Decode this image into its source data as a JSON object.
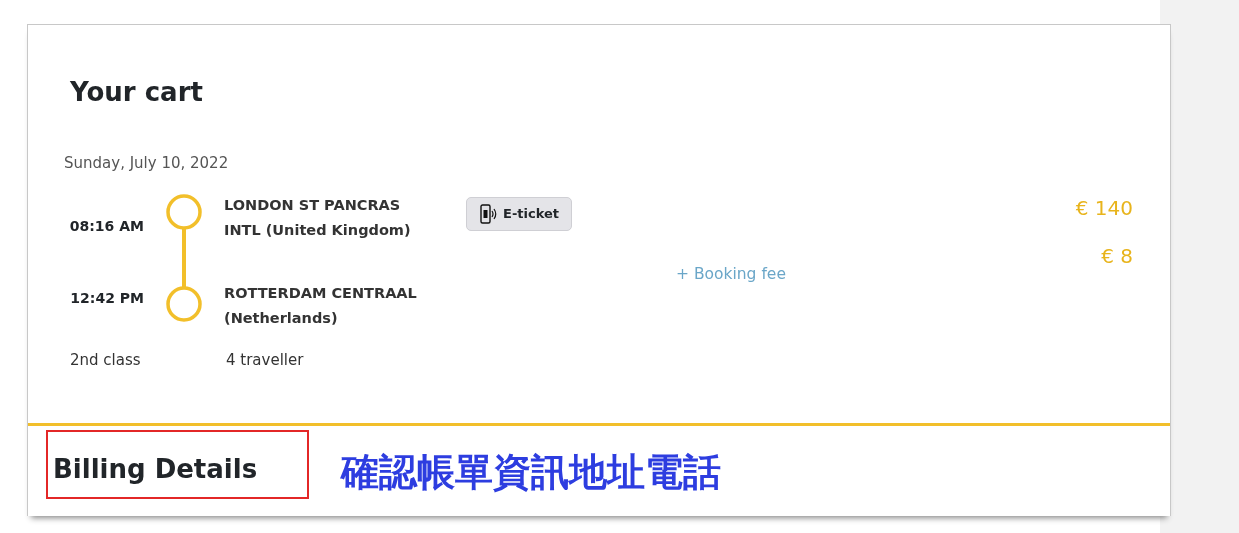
{
  "cart": {
    "title": "Your cart",
    "date": "Sunday, July 10, 2022",
    "stops": [
      {
        "time": "08:16 AM",
        "station": "LONDON ST PANCRAS",
        "country": "INTL (United Kingdom)"
      },
      {
        "time": "12:42 PM",
        "station": "ROTTERDAM CENTRAAL",
        "country": "(Netherlands)"
      }
    ],
    "ticket_badge": "E-ticket",
    "booking_fee": "+ Booking fee",
    "price": "€ 140",
    "fee_price": "€ 8",
    "travel_class": "2nd class",
    "travellers": "4 traveller"
  },
  "billing": {
    "title": "Billing Details",
    "highlighted": true
  },
  "annotation": {
    "text": "確認帳單資訊地址電話"
  }
}
